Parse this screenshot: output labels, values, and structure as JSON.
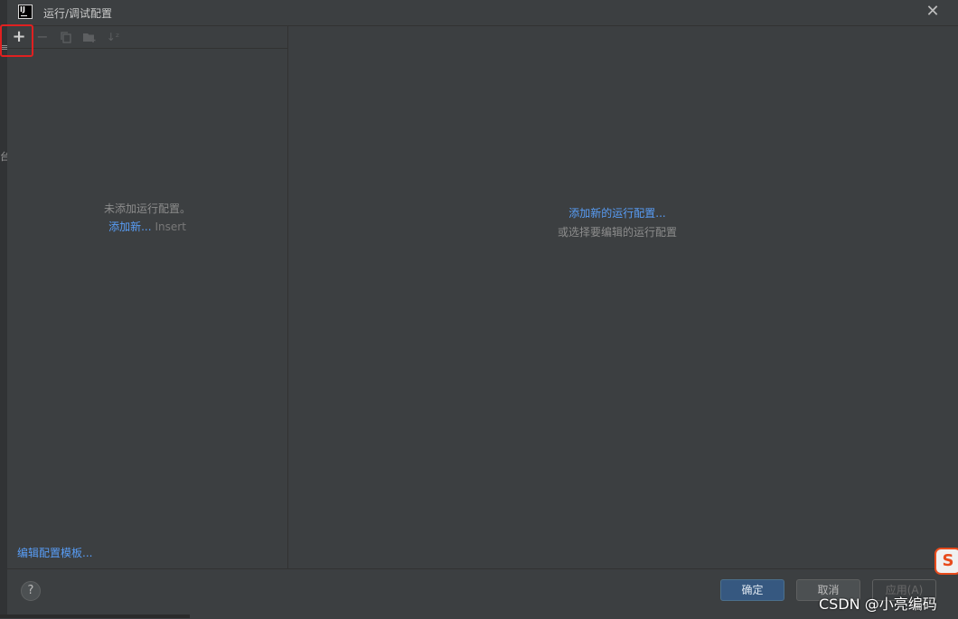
{
  "window": {
    "title": "运行/调试配置",
    "logo_text": "IJ",
    "close_glyph": "✕"
  },
  "edge": {
    "glyph_top": "≡",
    "glyph_mid": "台"
  },
  "toolbar": {
    "add_icon": "+",
    "remove_icon": "−",
    "sort_icon": "↓ᶻ"
  },
  "left_panel": {
    "empty_text": "未添加运行配置。",
    "add_new_link": "添加新...",
    "add_new_shortcut": "Insert",
    "edit_templates_link": "编辑配置模板..."
  },
  "right_panel": {
    "add_new_config_link": "添加新的运行配置...",
    "select_hint": "或选择要编辑的运行配置"
  },
  "footer": {
    "help_label": "?",
    "ok_label": "确定",
    "cancel_label": "取消",
    "apply_label": "应用(A)"
  },
  "overlay": {
    "watermark": "CSDN @小亮编码",
    "badge_letter": "S"
  },
  "colors": {
    "background": "#3c3f41",
    "link": "#589df6",
    "ok_button": "#365880",
    "highlight": "#e02020"
  }
}
